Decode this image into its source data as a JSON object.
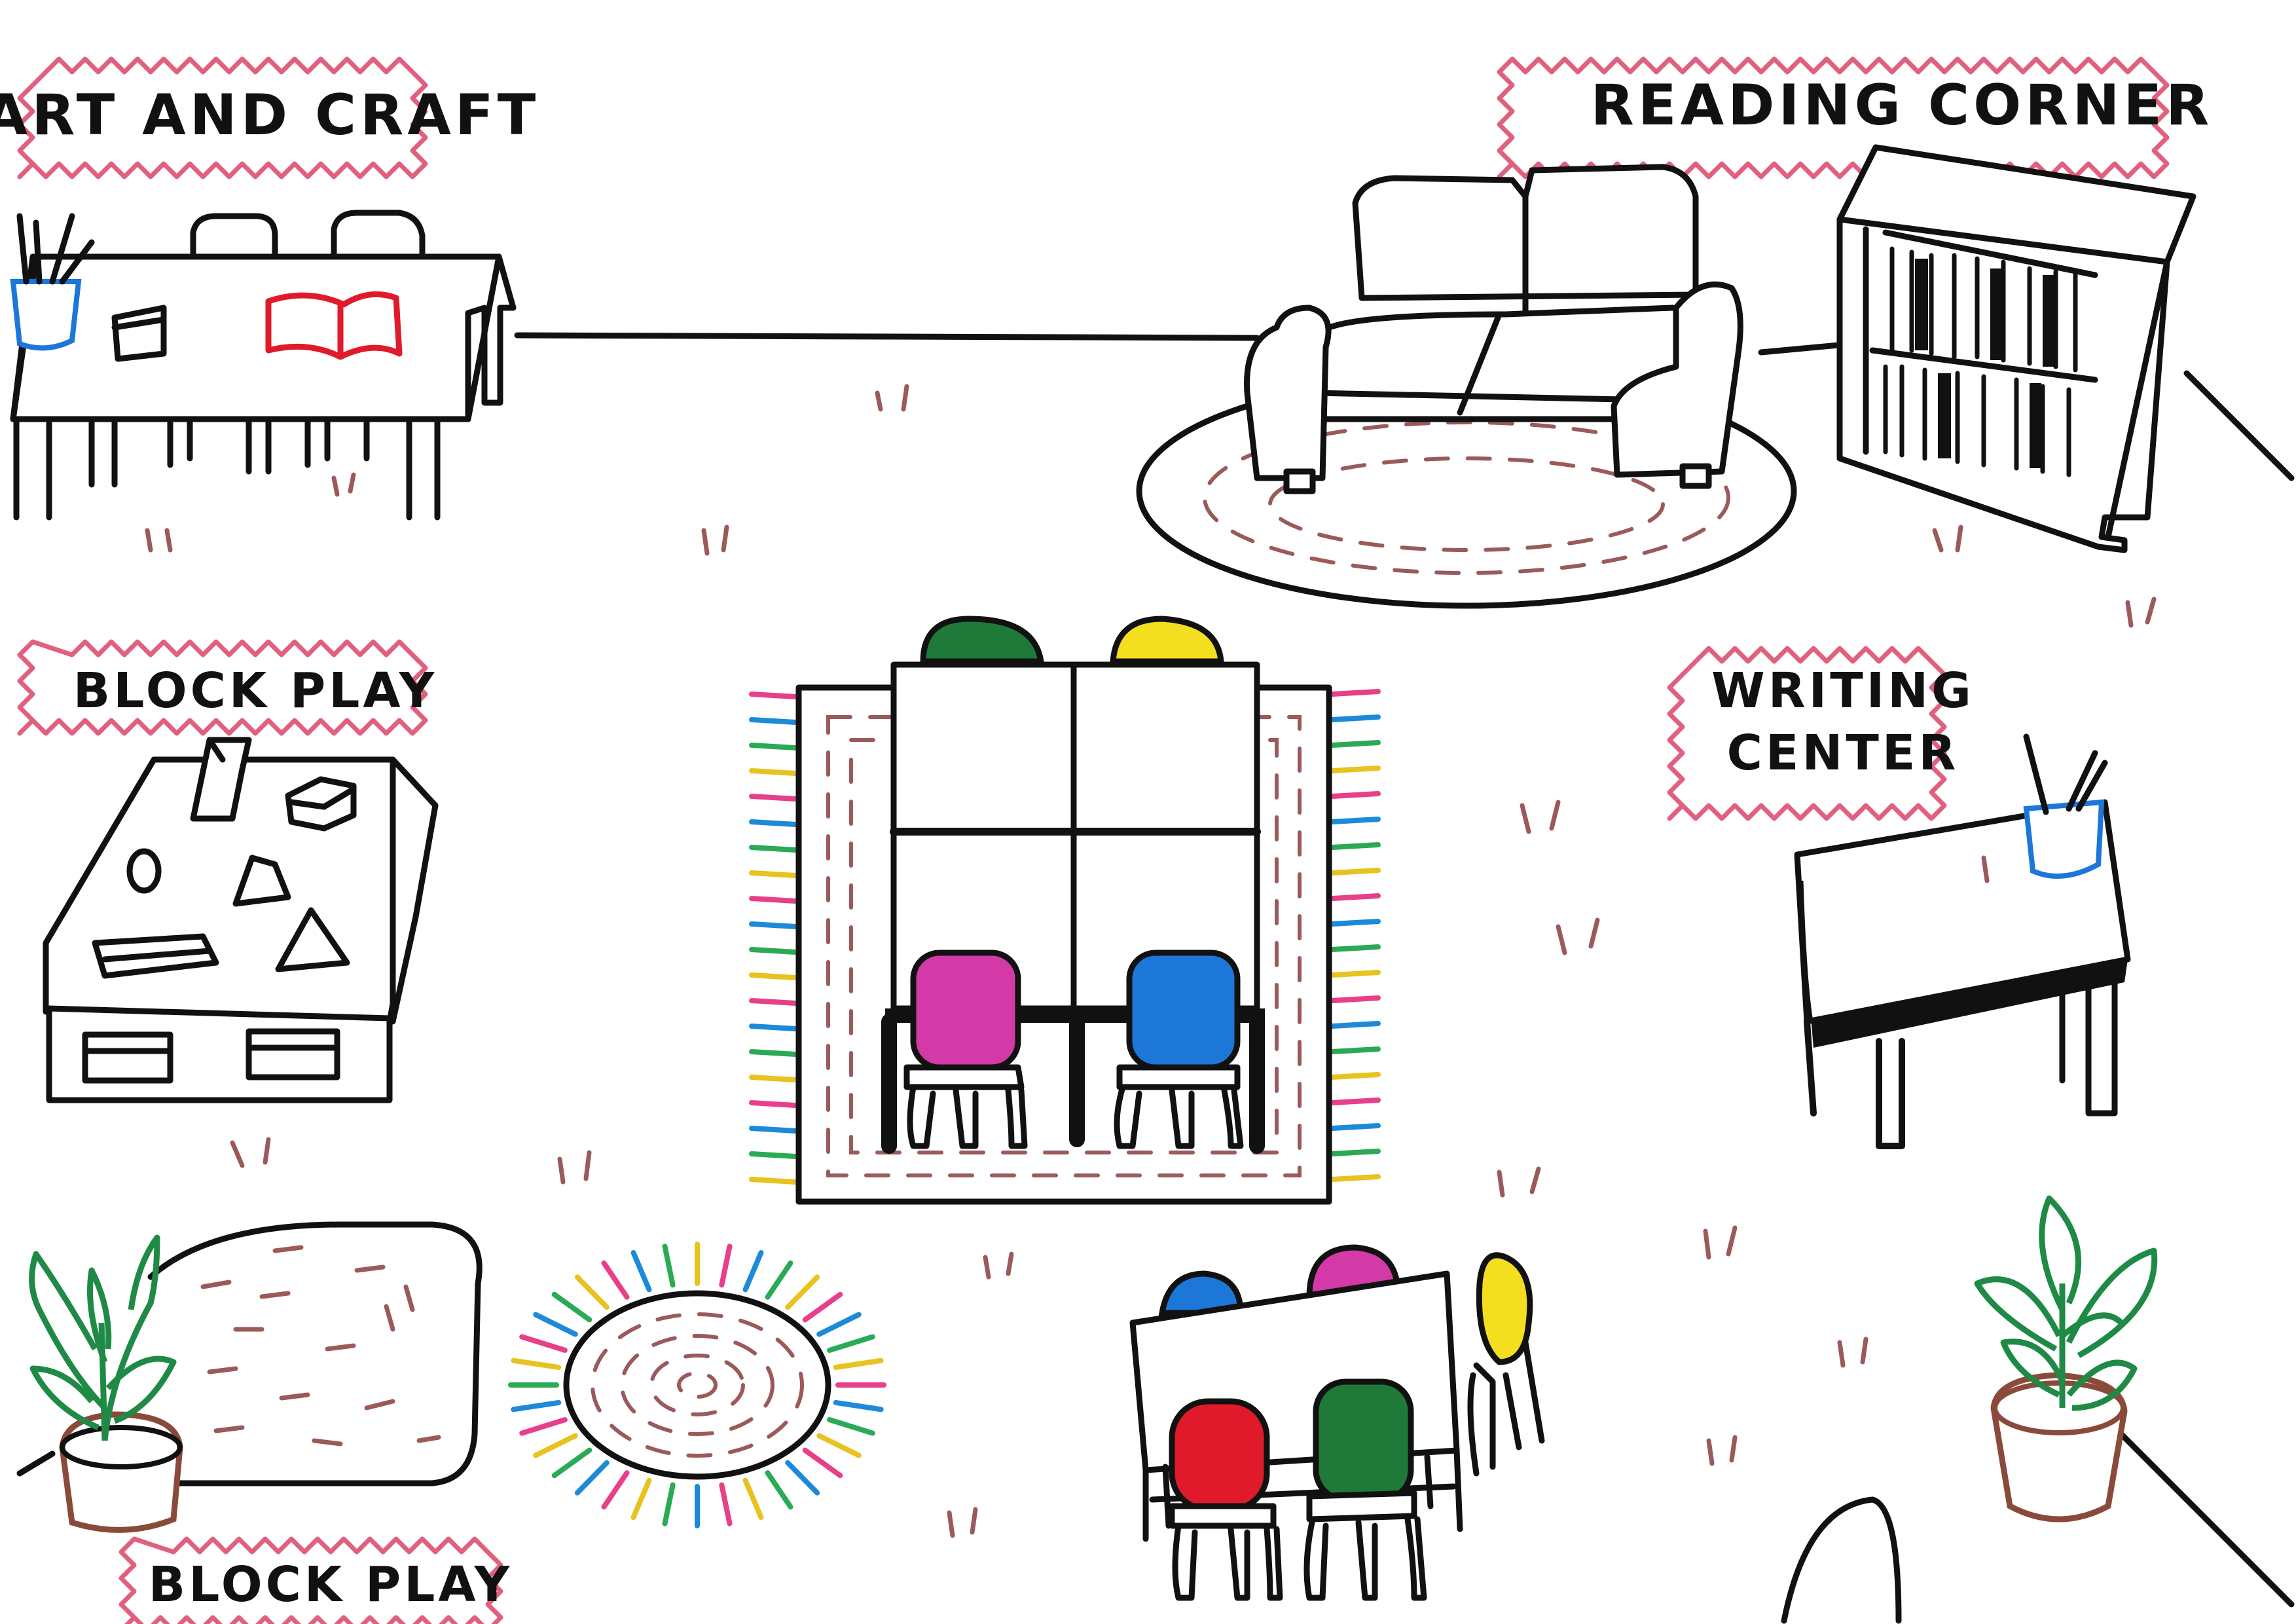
{
  "labels": {
    "art_and_craft": "ART AND CRAFT",
    "reading_corner": "READING CORNER",
    "block_play_top": "BLOCK PLAY",
    "writing_center_line1": "WRITING",
    "writing_center_line2": "CENTER",
    "block_play_bottom": "BLOCK PLAY"
  },
  "colors": {
    "outline": "#111111",
    "label_border": "#e0607e",
    "rug_dash": "#9b5a5a",
    "chair_green": "#1f7a3a",
    "chair_yellow": "#f3df1f",
    "chair_magenta": "#d33aa8",
    "chair_blue": "#1c77d9",
    "chair_red": "#e01a2a",
    "book_red": "#e01a2a",
    "cup_blue": "#1c77d9",
    "plant_green": "#1f8a45",
    "pot_brown": "#8a4a3a",
    "fringe": [
      "#e83f8a",
      "#1c8ad9",
      "#2aaa55",
      "#e8c21f"
    ]
  },
  "icons": [
    "art-table-icon",
    "sofa-icon",
    "bookshelf-icon",
    "block-table-icon",
    "group-table-icon",
    "writing-desk-icon",
    "potted-plant-icon",
    "round-rug-icon",
    "play-mat-icon"
  ]
}
